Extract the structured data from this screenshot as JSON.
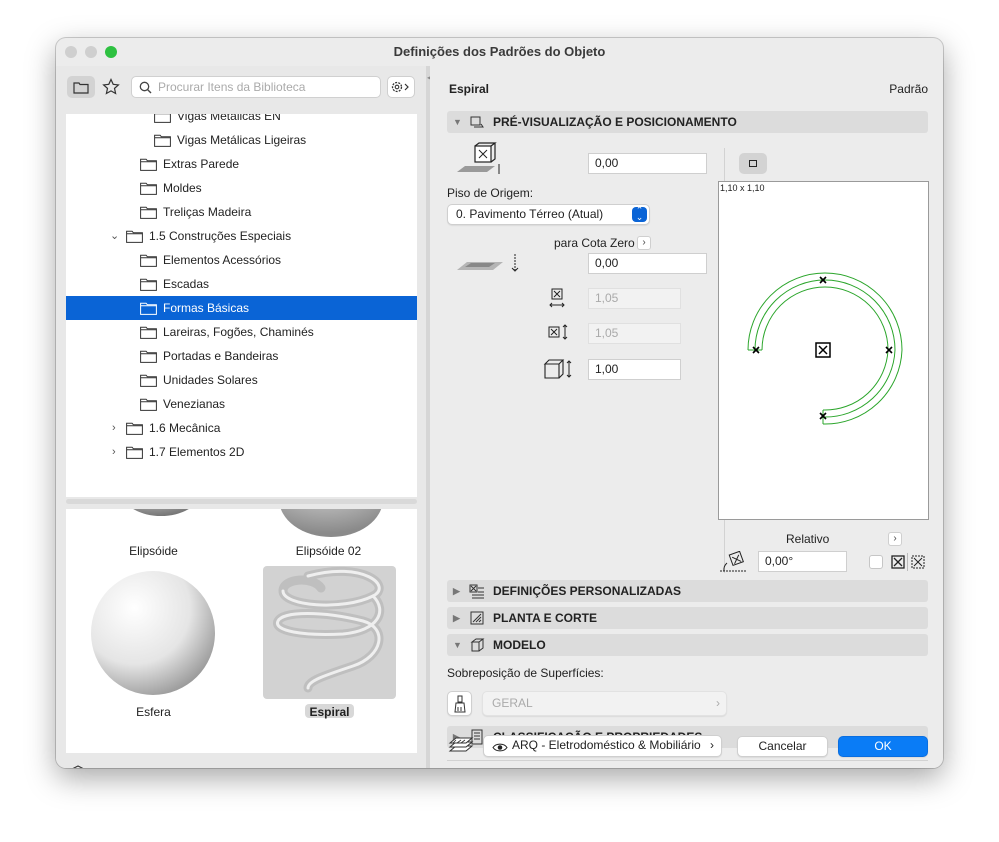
{
  "window": {
    "title": "Definições dos Padrões do Objeto"
  },
  "colors": {
    "accent": "#0a64d6",
    "preview_stroke": "#2aa52a"
  },
  "library": {
    "search_placeholder": "Procurar Itens da Biblioteca",
    "tree": [
      {
        "label": "Vigas Metálicas EN"
      },
      {
        "label": "Vigas Metálicas Ligeiras"
      },
      {
        "label": "Extras Parede"
      },
      {
        "label": "Moldes"
      },
      {
        "label": "Treliças Madeira"
      },
      {
        "label": "1.5 Construções Especiais"
      },
      {
        "label": "Elementos Acessórios"
      },
      {
        "label": "Escadas"
      },
      {
        "label": "Formas Básicas"
      },
      {
        "label": "Lareiras, Fogões, Chaminés"
      },
      {
        "label": "Portadas e Bandeiras"
      },
      {
        "label": "Unidades Solares"
      },
      {
        "label": "Venezianas"
      },
      {
        "label": "1.6 Mecânica"
      },
      {
        "label": "1.7 Elementos 2D"
      }
    ],
    "thumbnails": [
      {
        "label": "Elipsóide"
      },
      {
        "label": "Elipsóide 02"
      },
      {
        "label": "Esfera"
      },
      {
        "label": "Espiral"
      }
    ]
  },
  "settings": {
    "object_name": "Espiral",
    "mode": "Padrão",
    "sections": {
      "preview": "PRÉ-VISUALIZAÇÃO E POSICIONAMENTO",
      "custom": "DEFINIÇÕES PERSONALIZADAS",
      "plan": "PLANTA E CORTE",
      "model": "MODELO",
      "classification": "CLASSIFICAÇÃO E PROPRIEDADES"
    },
    "elevation_value": "0,00",
    "origin_floor_label": "Piso de Origem:",
    "origin_floor_value": "0. Pavimento Térreo (Atual)",
    "zero_level_link": "para Cota Zero",
    "offset_value": "0,00",
    "width_value": "1,05",
    "depth_value": "1,05",
    "height_value": "1,00",
    "preview_size": "1,10 x 1,10",
    "relative_label": "Relativo",
    "angle_value": "0,00°",
    "surface_override_label": "Sobreposição de Superfícies:",
    "surface_value": "GERAL",
    "layer_value": "ARQ - Eletrodoméstico & Mobiliário",
    "cancel_label": "Cancelar",
    "ok_label": "OK"
  }
}
